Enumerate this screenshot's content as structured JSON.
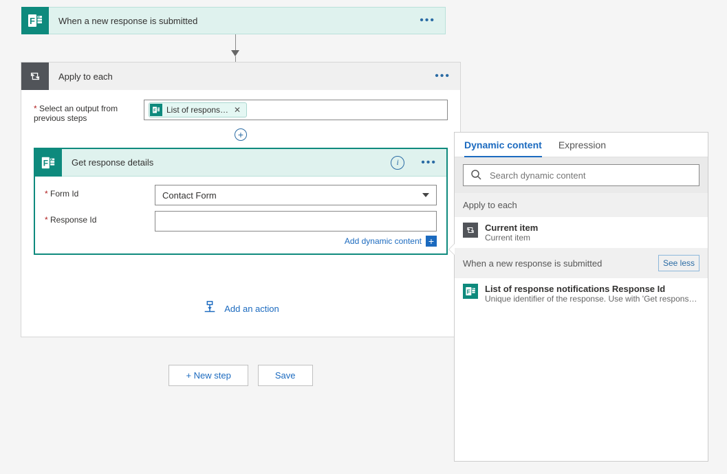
{
  "trigger": {
    "title": "When a new response is submitted"
  },
  "apply": {
    "title": "Apply to each",
    "output_label": "Select an output from previous steps",
    "token_label": "List of respons…"
  },
  "getResponse": {
    "title": "Get response details",
    "form_id_label": "Form Id",
    "form_id_value": "Contact Form",
    "response_id_label": "Response Id",
    "response_id_value": "",
    "add_dynamic_label": "Add dynamic content"
  },
  "addAction": "Add an action",
  "buttons": {
    "newStep": "+ New step",
    "save": "Save"
  },
  "dyn": {
    "tabDynamic": "Dynamic content",
    "tabExpression": "Expression",
    "searchPlaceholder": "Search dynamic content",
    "sections": {
      "apply": {
        "header": "Apply to each",
        "item_title": "Current item",
        "item_desc": "Current item"
      },
      "trigger": {
        "header": "When a new response is submitted",
        "see_less": "See less",
        "item_title": "List of response notifications Response Id",
        "item_desc": "Unique identifier of the response. Use with 'Get response de…"
      }
    }
  }
}
